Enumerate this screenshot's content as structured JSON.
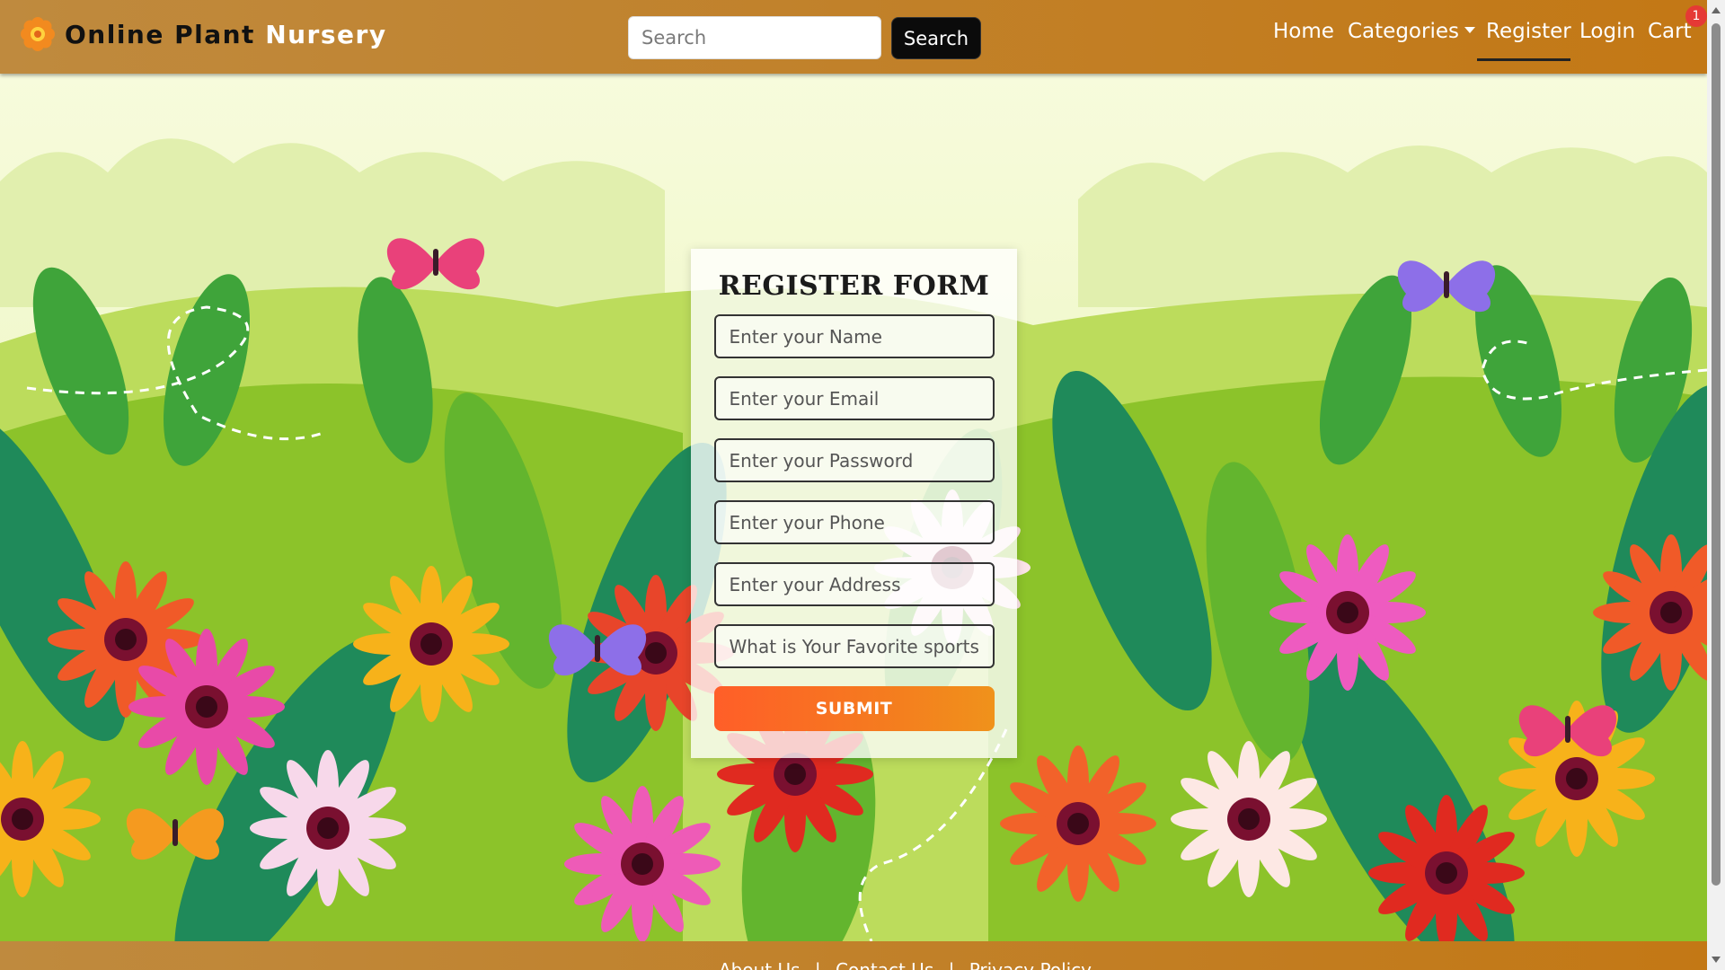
{
  "brand": {
    "name_dark": "Online Plant ",
    "name_light": "Nursery",
    "icon": "flower-icon"
  },
  "search": {
    "placeholder": "Search",
    "value": "",
    "button_label": "Search"
  },
  "nav": {
    "home": "Home",
    "categories": "Categories",
    "register": "Register",
    "login": "Login",
    "cart": "Cart",
    "cart_count": "1"
  },
  "form": {
    "title": "REGISTER FORM",
    "fields": [
      {
        "placeholder": "Enter your Name"
      },
      {
        "placeholder": "Enter your Email"
      },
      {
        "placeholder": "Enter your Password"
      },
      {
        "placeholder": "Enter your Phone"
      },
      {
        "placeholder": "Enter your Address"
      },
      {
        "placeholder": "What is Your Favorite sports"
      }
    ],
    "submit_label": "SUBMIT"
  },
  "footer": {
    "links": [
      "About Us",
      "Contact Us",
      "Privacy Policy"
    ]
  },
  "colors": {
    "navbar": "#c1812a",
    "submit": "#f57b1f",
    "badge": "#e53935"
  }
}
